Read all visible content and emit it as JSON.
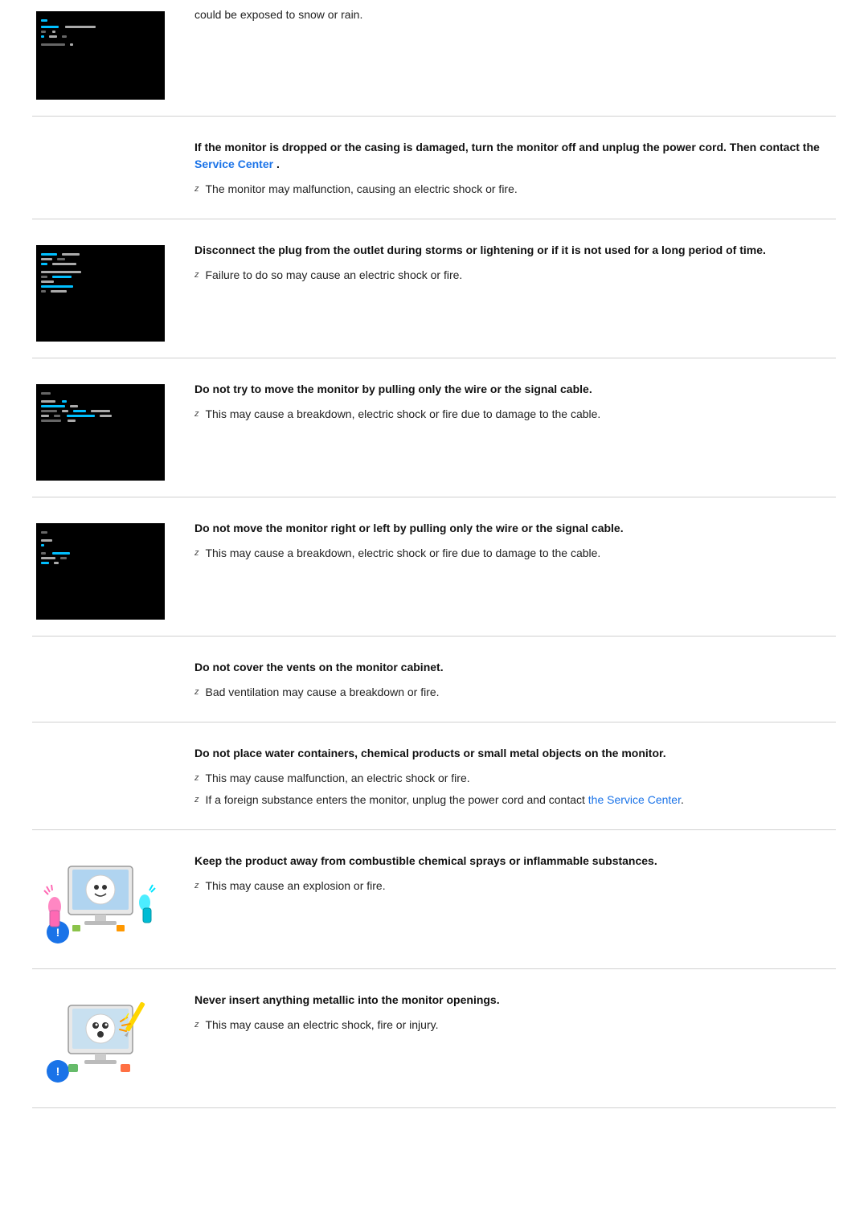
{
  "sections": [
    {
      "id": "snow-rain",
      "has_image": true,
      "image_type": "monitor",
      "title": null,
      "content_text": "could be exposed to snow or rain.",
      "bullets": []
    },
    {
      "id": "dropped",
      "has_image": false,
      "image_type": null,
      "title": "If the monitor is dropped or the casing is damaged, turn the monitor off and unplug the power cord. Then contact the Service Center .",
      "title_link": "Service Center",
      "bullets": [
        "The monitor may malfunction, causing an electric shock or fire."
      ]
    },
    {
      "id": "disconnect-storm",
      "has_image": true,
      "image_type": "monitor",
      "title": "Disconnect the plug from the outlet during storms or lightening or if it is not used for a long period of time.",
      "bullets": [
        "Failure to do so may cause an electric shock or fire."
      ]
    },
    {
      "id": "move-wire",
      "has_image": true,
      "image_type": "monitor",
      "title": "Do not try to move the monitor by pulling only the wire or the signal cable.",
      "bullets": [
        "This may cause a breakdown, electric shock or fire due to damage to the cable."
      ]
    },
    {
      "id": "move-left-right",
      "has_image": true,
      "image_type": "monitor",
      "title": "Do not move the monitor right or left by pulling only the wire or the signal cable.",
      "bullets": [
        "This may cause a breakdown, electric shock or fire due to damage to the cable."
      ]
    },
    {
      "id": "vents",
      "has_image": false,
      "image_type": null,
      "title": "Do not cover the vents on the monitor cabinet.",
      "bullets": [
        "Bad ventilation may cause a breakdown or fire."
      ]
    },
    {
      "id": "water-containers",
      "has_image": false,
      "image_type": null,
      "title": "Do not place water containers, chemical products or small metal objects on the monitor.",
      "bullets": [
        "This may cause malfunction, an electric shock or fire.",
        "If a foreign substance enters the monitor, unplug the power cord and contact the Service Center."
      ],
      "bullet_links": [
        1
      ]
    },
    {
      "id": "chemical-sprays",
      "has_image": true,
      "image_type": "illustration",
      "title": "Keep the product away from combustible chemical sprays or inflammable substances.",
      "bullets": [
        "This may cause an explosion or fire."
      ]
    },
    {
      "id": "metallic",
      "has_image": true,
      "image_type": "illustration",
      "title": "Never insert anything metallic into the monitor openings.",
      "bullets": [
        "This may cause an electric shock, fire or injury."
      ]
    }
  ],
  "links": {
    "service_center_1": "Service Center",
    "service_center_2": "the Service Center"
  }
}
